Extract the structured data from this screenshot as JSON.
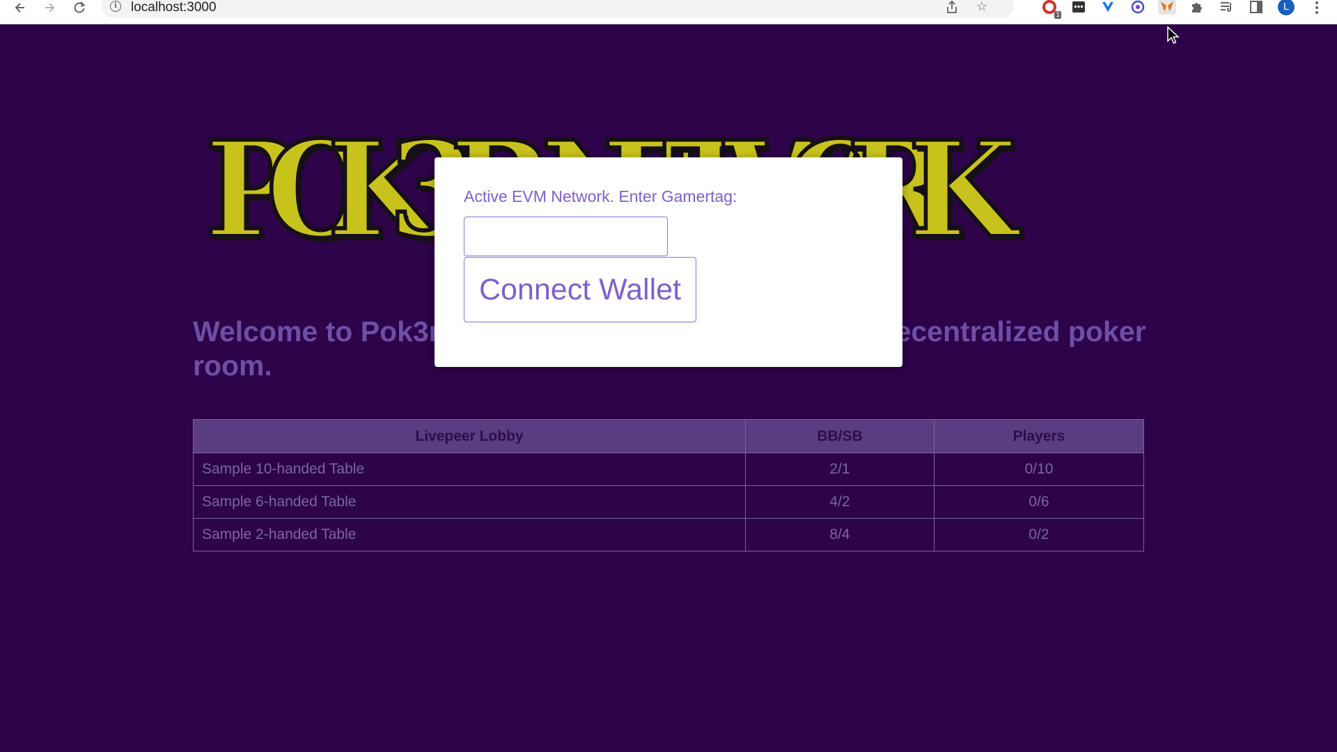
{
  "browser": {
    "url": "localhost:3000",
    "back_icon": "arrow-left",
    "forward_icon": "arrow-right",
    "reload_icon": "reload",
    "extensions": [
      {
        "name": "adblock-icon",
        "badge": "1",
        "color": "#d93025"
      },
      {
        "name": "dashlane-icon",
        "color": "#333333"
      },
      {
        "name": "vue-devtools-icon",
        "color": "#1a73e8"
      },
      {
        "name": "coin-icon",
        "color": "#3b4bd8"
      },
      {
        "name": "metamask-icon",
        "color": "#e2761b"
      },
      {
        "name": "puzzle-icon",
        "color": "#5f6368"
      },
      {
        "name": "reading-list-icon",
        "color": "#5f6368"
      },
      {
        "name": "side-panel-icon",
        "color": "#5f6368"
      }
    ],
    "profile_initial": "L",
    "profile_color": "#1a5fbf"
  },
  "page": {
    "logo_text": "POK3R NETWORK",
    "welcome_text": "Welcome to Pok3r Network, a multiplayer onchain decentralized poker room.",
    "lobby": {
      "columns": [
        "Livepeer Lobby",
        "BB/SB",
        "Players"
      ],
      "rows": [
        {
          "name": "Sample 10-handed Table",
          "blinds": "2/1",
          "players": "0/10"
        },
        {
          "name": "Sample 6-handed Table",
          "blinds": "4/2",
          "players": "0/6"
        },
        {
          "name": "Sample 2-handed Table",
          "blinds": "8/4",
          "players": "0/2"
        }
      ]
    }
  },
  "modal": {
    "label": "Active EVM Network. Enter Gamertag:",
    "gamertag_value": "",
    "connect_label": "Connect Wallet"
  },
  "colors": {
    "background": "#2d0349",
    "accent": "#7e5fcf",
    "logo_yellow": "#c8c21d"
  }
}
